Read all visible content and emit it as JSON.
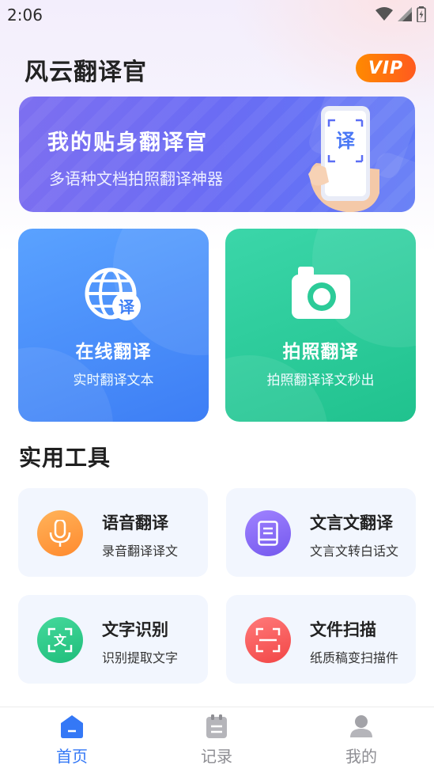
{
  "status_bar": {
    "time": "2:06"
  },
  "header": {
    "app_title": "风云翻译官",
    "vip_label": "VIP"
  },
  "banner": {
    "title": "我的贴身翻译官",
    "subtitle": "多语种文档拍照翻译神器",
    "phone_glyph": "译"
  },
  "main_cards": [
    {
      "title": "在线翻译",
      "subtitle": "实时翻译文本",
      "icon": "globe-translate-icon",
      "badge": "译",
      "color": "#4a8ff8"
    },
    {
      "title": "拍照翻译",
      "subtitle": "拍照翻译译文秒出",
      "icon": "camera-icon",
      "color": "#2ccb98"
    }
  ],
  "tools_section": {
    "title": "实用工具"
  },
  "tools": [
    {
      "title": "语音翻译",
      "subtitle": "录音翻译译文",
      "icon": "microphone-icon",
      "color": "#ff9a3c"
    },
    {
      "title": "文言文翻译",
      "subtitle": "文言文转白话文",
      "icon": "book-icon",
      "color": "#8a6cf2"
    },
    {
      "title": "文字识别",
      "subtitle": "识别提取文字",
      "icon": "text-scan-icon",
      "glyph": "文",
      "color": "#2fc98a"
    },
    {
      "title": "文件扫描",
      "subtitle": "纸质稿变扫描件",
      "icon": "scan-icon",
      "color": "#f85a5a"
    }
  ],
  "tabbar": {
    "items": [
      {
        "label": "首页",
        "icon": "home-icon",
        "active": true
      },
      {
        "label": "记录",
        "icon": "clipboard-icon",
        "active": false
      },
      {
        "label": "我的",
        "icon": "user-icon",
        "active": false
      }
    ],
    "active_color": "#3478f6",
    "inactive_color": "#8e8e93"
  }
}
